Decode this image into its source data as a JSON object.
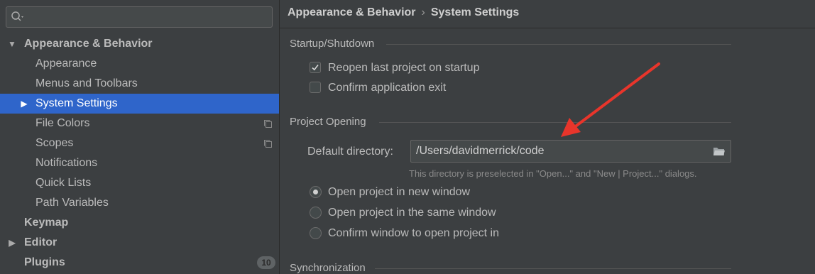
{
  "sidebar": {
    "search": {
      "placeholder": "",
      "value": ""
    },
    "items": [
      {
        "label": "Appearance & Behavior",
        "expanded": true
      },
      {
        "label": "Appearance"
      },
      {
        "label": "Menus and Toolbars"
      },
      {
        "label": "System Settings",
        "selected": true
      },
      {
        "label": "File Colors"
      },
      {
        "label": "Scopes"
      },
      {
        "label": "Notifications"
      },
      {
        "label": "Quick Lists"
      },
      {
        "label": "Path Variables"
      },
      {
        "label": "Keymap"
      },
      {
        "label": "Editor"
      },
      {
        "label": "Plugins",
        "badge": "10"
      }
    ]
  },
  "breadcrumb": {
    "parent": "Appearance & Behavior",
    "separator": "›",
    "current": "System Settings"
  },
  "startup": {
    "title": "Startup/Shutdown",
    "reopen_label": "Reopen last project on startup",
    "reopen_checked": true,
    "confirm_exit_label": "Confirm application exit",
    "confirm_exit_checked": false
  },
  "project_opening": {
    "title": "Project Opening",
    "default_dir_label": "Default directory:",
    "default_dir_value": "/Users/davidmerrick/code",
    "hint": "This directory is preselected in \"Open...\" and \"New | Project...\" dialogs.",
    "options": [
      {
        "label": "Open project in new window",
        "selected": true
      },
      {
        "label": "Open project in the same window",
        "selected": false
      },
      {
        "label": "Confirm window to open project in",
        "selected": false
      }
    ]
  },
  "synchronization": {
    "title": "Synchronization"
  },
  "colors": {
    "background": "#3c3f41",
    "selection": "#2f65ca",
    "annotation_arrow": "#e8352b"
  },
  "icons": [
    "search-icon",
    "expand-arrow-icon",
    "collapse-arrow-icon",
    "copy-icon",
    "checkmark-icon",
    "folder-icon",
    "annotation-arrow"
  ]
}
